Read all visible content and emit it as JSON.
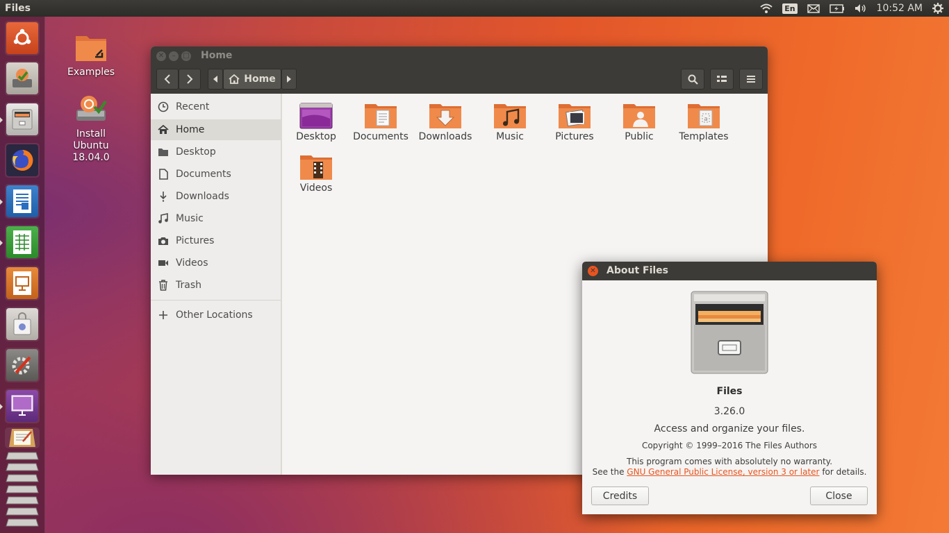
{
  "topbar": {
    "app_name": "Files",
    "keyboard_layout": "En",
    "clock": "10:52 AM",
    "icons": [
      "wifi-icon",
      "mail-icon",
      "battery-icon",
      "volume-icon",
      "gear-icon"
    ]
  },
  "launcher": {
    "items": [
      "ubuntu-dash",
      "install-ubuntu",
      "files",
      "firefox",
      "libreoffice-writer",
      "libreoffice-calc",
      "libreoffice-impress",
      "ubuntu-software",
      "system-settings",
      "desktop-monitor",
      "text-editor",
      "workspaces"
    ]
  },
  "desktop": {
    "icons": [
      {
        "label": "Examples"
      },
      {
        "label_line1": "Install",
        "label_line2": "Ubuntu",
        "label_line3": "18.04.0"
      }
    ]
  },
  "window": {
    "title": "Home",
    "path_label": "Home",
    "sidebar": {
      "items": [
        {
          "label": "Recent",
          "icon": "clock-icon"
        },
        {
          "label": "Home",
          "icon": "home-icon",
          "active": true
        },
        {
          "label": "Desktop",
          "icon": "folder-icon"
        },
        {
          "label": "Documents",
          "icon": "document-icon"
        },
        {
          "label": "Downloads",
          "icon": "download-icon"
        },
        {
          "label": "Music",
          "icon": "music-icon"
        },
        {
          "label": "Pictures",
          "icon": "camera-icon"
        },
        {
          "label": "Videos",
          "icon": "video-icon"
        },
        {
          "label": "Trash",
          "icon": "trash-icon"
        }
      ],
      "other_locations": "Other Locations"
    },
    "folders": [
      {
        "label": "Desktop"
      },
      {
        "label": "Documents"
      },
      {
        "label": "Downloads"
      },
      {
        "label": "Music"
      },
      {
        "label": "Pictures"
      },
      {
        "label": "Public"
      },
      {
        "label": "Templates"
      },
      {
        "label": "Videos"
      }
    ]
  },
  "about": {
    "title": "About Files",
    "app_name": "Files",
    "version": "3.26.0",
    "description": "Access and organize your files.",
    "copyright": "Copyright © 1999–2016 The Files Authors",
    "warranty": "This program comes with absolutely no warranty.",
    "license_prefix": "See the ",
    "license_link": "GNU General Public License, version 3 or later",
    "license_suffix": " for details.",
    "credits_label": "Credits",
    "close_label": "Close"
  },
  "colors": {
    "accent": "#e95420",
    "panel": "#3c3b37",
    "folder": "#f08a4b"
  }
}
